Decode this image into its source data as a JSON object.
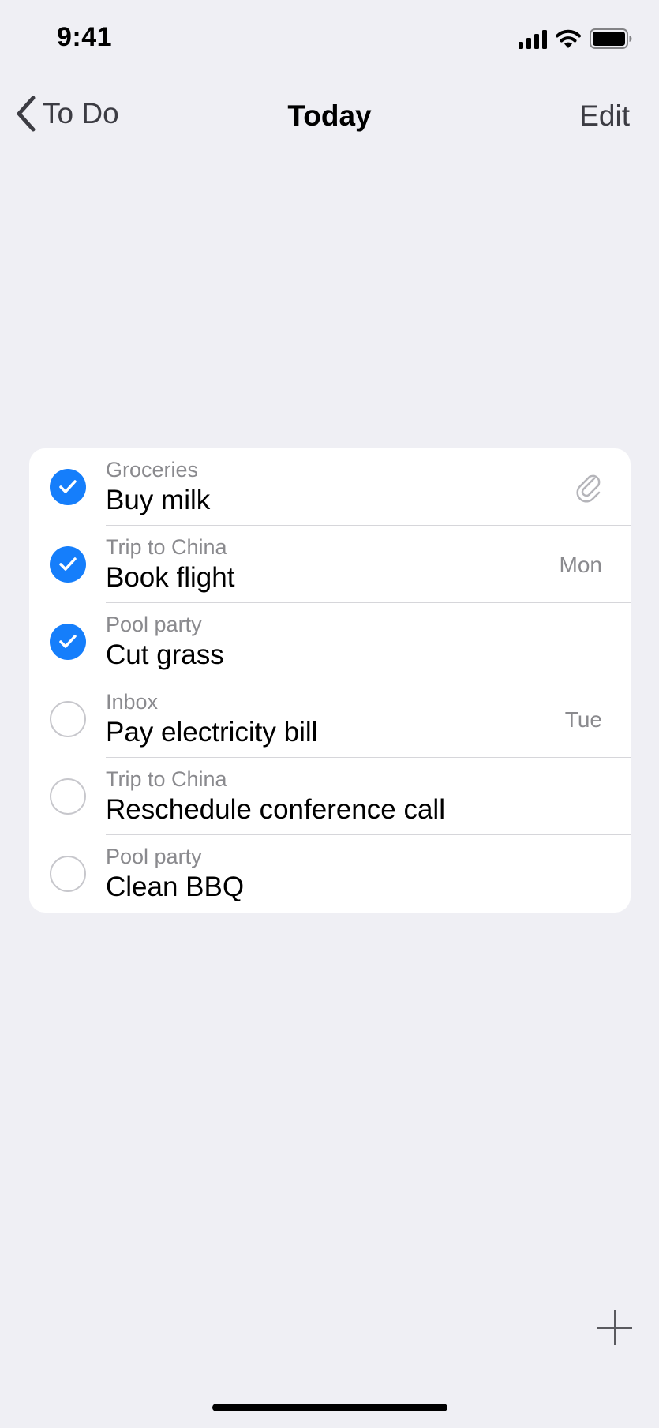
{
  "status_bar": {
    "time": "9:41",
    "icons": [
      "signal-icon",
      "wifi-icon",
      "battery-icon"
    ]
  },
  "nav": {
    "back_label": "To Do",
    "title": "Today",
    "edit_label": "Edit"
  },
  "colors": {
    "accent": "#157efb",
    "background": "#efeff4",
    "secondary_text": "#8a8a8e"
  },
  "tasks": [
    {
      "list": "Groceries",
      "title": "Buy milk",
      "completed": true,
      "due": "",
      "attachment_icon": "paperclip-icon"
    },
    {
      "list": "Trip to China",
      "title": "Book flight",
      "completed": true,
      "due": "Mon"
    },
    {
      "list": "Pool party",
      "title": "Cut grass",
      "completed": true,
      "due": ""
    },
    {
      "list": "Inbox",
      "title": "Pay electricity bill",
      "completed": false,
      "due": "Tue"
    },
    {
      "list": "Trip to China",
      "title": "Reschedule conference call",
      "completed": false,
      "due": ""
    },
    {
      "list": "Pool party",
      "title": "Clean BBQ",
      "completed": false,
      "due": ""
    }
  ],
  "add_button_icon": "plus-icon"
}
